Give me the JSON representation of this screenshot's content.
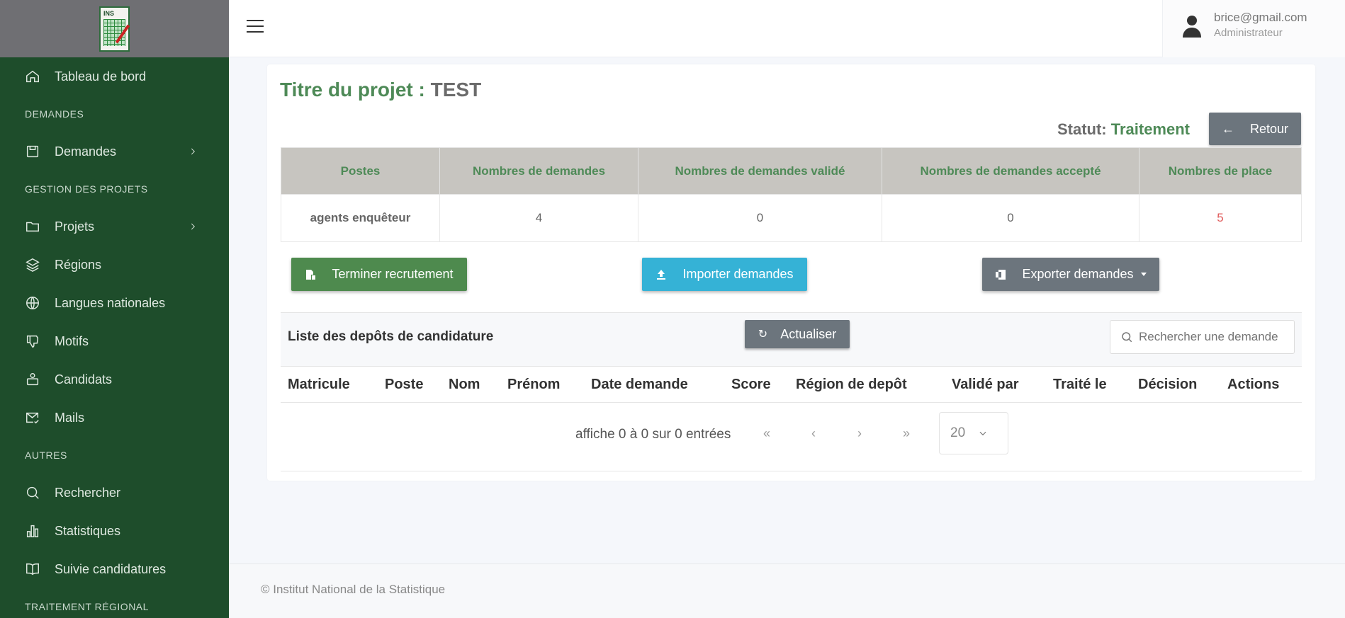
{
  "sidebar": {
    "items": [
      {
        "label": "Tableau de bord",
        "icon": "home-icon"
      },
      {
        "section": "DEMANDES"
      },
      {
        "label": "Demandes",
        "icon": "calendar-icon",
        "chevron": true
      },
      {
        "section": "GESTION DES PROJETS"
      },
      {
        "label": "Projets",
        "icon": "folder-icon",
        "chevron": true
      },
      {
        "label": "Régions",
        "icon": "layers-icon"
      },
      {
        "label": "Langues nationales",
        "icon": "globe-icon"
      },
      {
        "label": "Motifs",
        "icon": "thumbs-down-icon"
      },
      {
        "label": "Candidats",
        "icon": "briefcase-user-icon"
      },
      {
        "label": "Mails",
        "icon": "mail-check-icon"
      },
      {
        "section": "AUTRES"
      },
      {
        "label": "Rechercher",
        "icon": "search-icon"
      },
      {
        "label": "Statistiques",
        "icon": "bar-chart-icon"
      },
      {
        "label": "Suivie candidatures",
        "icon": "book-icon"
      },
      {
        "section": "TRAITEMENT RÉGIONAL"
      }
    ]
  },
  "header": {
    "user_email": "brice@gmail.com",
    "user_role": "Administrateur"
  },
  "project": {
    "title_label": "Titre du projet : ",
    "title_value": "TEST",
    "status_label": "Statut: ",
    "status_value": "Traitement",
    "back_label": "Retour"
  },
  "stats_table": {
    "headers": [
      "Postes",
      "Nombres de demandes",
      "Nombres de demandes validé",
      "Nombres de demandes accepté",
      "Nombres de place"
    ],
    "row": [
      "agents enquêteur",
      "4",
      "0",
      "0",
      "5"
    ]
  },
  "actions": {
    "finish_label": "Terminer recrutement",
    "import_label": "Importer demandes",
    "export_label": "Exporter demandes"
  },
  "list": {
    "title": "Liste des depôts de candidature",
    "refresh_label": "Actualiser",
    "search_placeholder": "Rechercher une demande",
    "columns": [
      "Matricule",
      "Poste",
      "Nom",
      "Prénom",
      "Date demande",
      "Score",
      "Région de depôt",
      "Validé par",
      "Traité le",
      "Décision",
      "Actions"
    ],
    "pagination_info": "affiche 0 à 0 sur 0 entrées",
    "page_first": "«",
    "page_prev": "‹",
    "page_next": "›",
    "page_last": "»",
    "page_size": "20"
  },
  "footer": {
    "text": "© Institut National de la Statistique"
  },
  "colors": {
    "sidebar_bg": "#1e4d2b",
    "accent_green": "#4e8a57",
    "info_blue": "#35b2d6",
    "secondary_gray": "#6c757d",
    "danger_red": "#e05a5a"
  }
}
